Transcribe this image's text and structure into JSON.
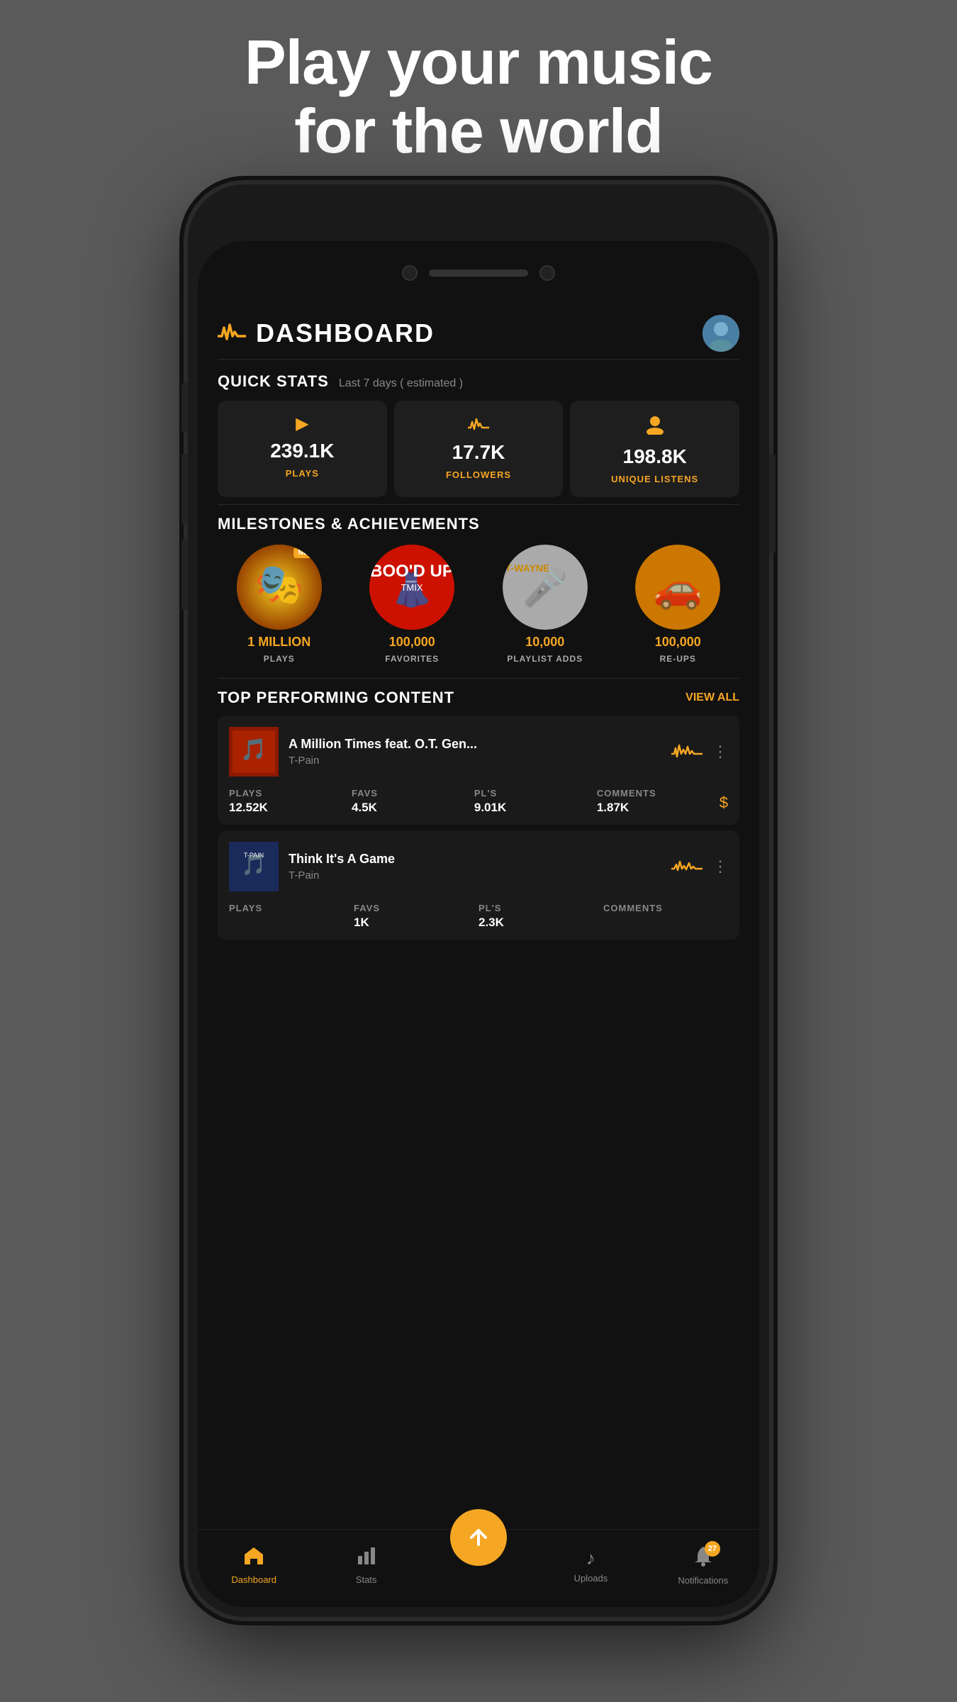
{
  "hero": {
    "line1": "Play your music",
    "line2": "for the world"
  },
  "header": {
    "title": "DASHBOARD",
    "logo_icon": "♪",
    "avatar_emoji": "👤"
  },
  "quick_stats": {
    "section_title": "QUICK STATS",
    "period": "Last 7 days ( estimated )",
    "stats": [
      {
        "icon": "▶",
        "value": "239.1K",
        "label": "PLAYS"
      },
      {
        "icon": "∿",
        "value": "17.7K",
        "label": "FOLLOWERS"
      },
      {
        "icon": "👤",
        "value": "198.8K",
        "label": "UNIQUE LISTENS"
      }
    ]
  },
  "milestones": {
    "section_title": "MILESTONES & ACHIEVEMENTS",
    "items": [
      {
        "badge": "NEW",
        "value": "1 MILLION",
        "label": "PLAYS"
      },
      {
        "badge": "",
        "value": "100,000",
        "label": "FAVORITES"
      },
      {
        "badge": "",
        "value": "10,000",
        "label": "PLAYLIST ADDS"
      },
      {
        "badge": "",
        "value": "100,000",
        "label": "RE-UPS"
      }
    ]
  },
  "top_content": {
    "section_title": "TOP PERFORMING CONTENT",
    "view_all_label": "VIEW ALL",
    "tracks": [
      {
        "name": "A Million Times feat. O.T. Gen...",
        "artist": "T-Pain",
        "stats": [
          {
            "label": "PLAYS",
            "value": "12.52K"
          },
          {
            "label": "FAVS",
            "value": "4.5K"
          },
          {
            "label": "PL'S",
            "value": "9.01K"
          },
          {
            "label": "COMMENTS",
            "value": "1.87K"
          }
        ]
      },
      {
        "name": "Think It's A Game",
        "artist": "T-Pain",
        "stats": [
          {
            "label": "PLAYS",
            "value": ""
          },
          {
            "label": "FAVS",
            "value": "1K"
          },
          {
            "label": "PL'S",
            "value": "2.3K"
          },
          {
            "label": "COMMENTS",
            "value": ""
          }
        ]
      }
    ]
  },
  "bottom_nav": {
    "items": [
      {
        "icon": "⌂",
        "label": "Dashboard",
        "active": true,
        "badge": ""
      },
      {
        "icon": "📊",
        "label": "Stats",
        "active": false,
        "badge": ""
      },
      {
        "icon": "⬆",
        "label": "",
        "active": false,
        "badge": "",
        "is_fab": true
      },
      {
        "icon": "♪",
        "label": "Uploads",
        "active": false,
        "badge": ""
      },
      {
        "icon": "🔔",
        "label": "Notifications",
        "active": false,
        "badge": "27"
      }
    ]
  }
}
